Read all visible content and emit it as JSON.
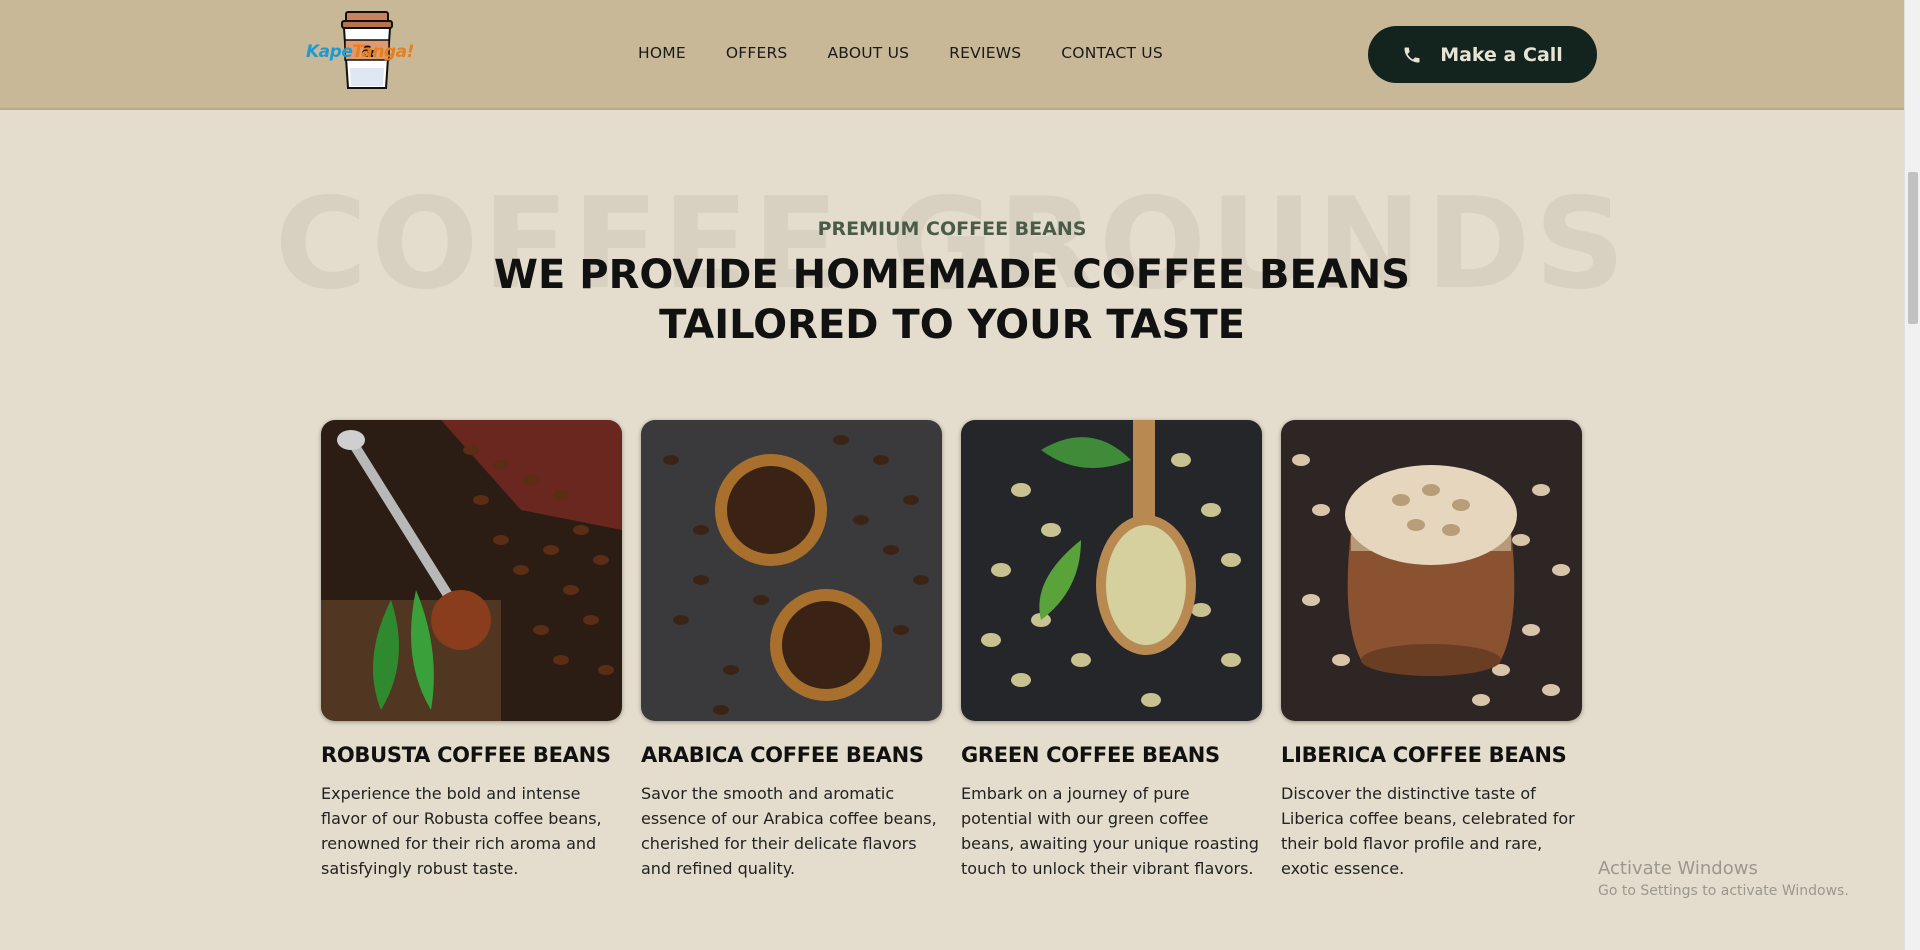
{
  "header": {
    "logo": {
      "text_part1": "Kape",
      "text_part2": "Tanga!"
    },
    "nav": [
      {
        "label": "HOME"
      },
      {
        "label": "OFFERS"
      },
      {
        "label": "ABOUT US"
      },
      {
        "label": "REVIEWS"
      },
      {
        "label": "CONTACT US"
      }
    ],
    "call_button": {
      "label": "Make a Call",
      "icon": "phone-icon"
    }
  },
  "section": {
    "watermark": "COFFEE GROUNDS",
    "eyebrow": "PREMIUM COFFEE BEANS",
    "headline": "WE PROVIDE HOMEMADE COFFEE BEANS TAILORED TO YOUR TASTE"
  },
  "products": [
    {
      "title": "ROBUSTA COFFEE BEANS",
      "description": "Experience the bold and intense flavor of our Robusta coffee beans, renowned for their rich aroma and satisfyingly robust taste.",
      "image": "robusta-beans-with-spoon-photo"
    },
    {
      "title": "ARABICA COFFEE BEANS",
      "description": "Savor the smooth and aromatic essence of our Arabica coffee beans, cherished for their delicate flavors and refined quality.",
      "image": "arabica-beans-in-wooden-bowls-photo"
    },
    {
      "title": "GREEN COFFEE BEANS",
      "description": "Embark on a journey of pure potential with our green coffee beans, awaiting your unique roasting touch to unlock their vibrant flavors.",
      "image": "green-beans-on-wooden-spoon-photo"
    },
    {
      "title": "LIBERICA COFFEE BEANS",
      "description": "Discover the distinctive taste of Liberica coffee beans, celebrated for their bold flavor profile and rare, exotic essence.",
      "image": "liberica-beans-in-wooden-jar-photo"
    }
  ],
  "os_overlay": {
    "title": "Activate Windows",
    "subtitle": "Go to Settings to activate Windows."
  },
  "colors": {
    "page_bg": "#e4ddcd",
    "header_bg": "#c8b898",
    "button_bg": "#13241f",
    "eyebrow": "#4a5c48"
  }
}
